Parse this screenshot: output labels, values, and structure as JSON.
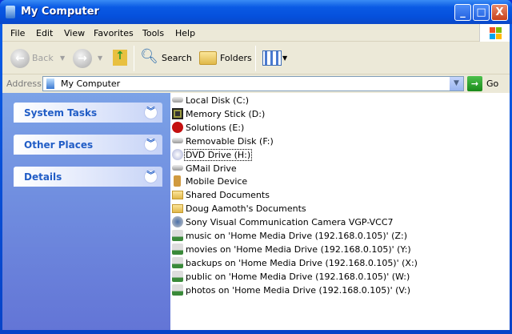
{
  "window": {
    "title": "My Computer",
    "buttons": {
      "minimize": "_",
      "maximize": "□",
      "close": "X"
    }
  },
  "menu": [
    "File",
    "Edit",
    "View",
    "Favorites",
    "Tools",
    "Help"
  ],
  "toolbar": {
    "back": "Back",
    "search": "Search",
    "folders": "Folders"
  },
  "address": {
    "label": "Address",
    "value": "My Computer",
    "go": "Go"
  },
  "sidebar": {
    "panels": [
      "System Tasks",
      "Other Places",
      "Details"
    ]
  },
  "items": [
    {
      "label": "Local Disk (C:)",
      "icon": "hard-disk-icon"
    },
    {
      "label": "Memory Stick (D:)",
      "icon": "memory-stick-icon"
    },
    {
      "label": "Solutions (E:)",
      "icon": "solutions-drive-icon"
    },
    {
      "label": "Removable Disk (F:)",
      "icon": "removable-disk-icon"
    },
    {
      "label": "DVD Drive (H:)",
      "icon": "dvd-drive-icon"
    },
    {
      "label": "GMail Drive",
      "icon": "hard-disk-icon"
    },
    {
      "label": "Mobile Device",
      "icon": "mobile-device-icon"
    },
    {
      "label": "Shared Documents",
      "icon": "folder-icon"
    },
    {
      "label": "Doug Aamoth's Documents",
      "icon": "folder-icon"
    },
    {
      "label": "Sony Visual Communication Camera VGP-VCC7",
      "icon": "camera-icon"
    },
    {
      "label": "music on 'Home Media Drive (192.168.0.105)' (Z:)",
      "icon": "network-drive-icon"
    },
    {
      "label": "movies on 'Home Media Drive (192.168.0.105)' (Y:)",
      "icon": "network-drive-icon"
    },
    {
      "label": "backups on 'Home Media Drive (192.168.0.105)' (X:)",
      "icon": "network-drive-icon"
    },
    {
      "label": "public on 'Home Media Drive (192.168.0.105)' (W:)",
      "icon": "network-drive-icon"
    },
    {
      "label": "photos on 'Home Media Drive (192.168.0.105)' (V:)",
      "icon": "network-drive-icon"
    }
  ]
}
